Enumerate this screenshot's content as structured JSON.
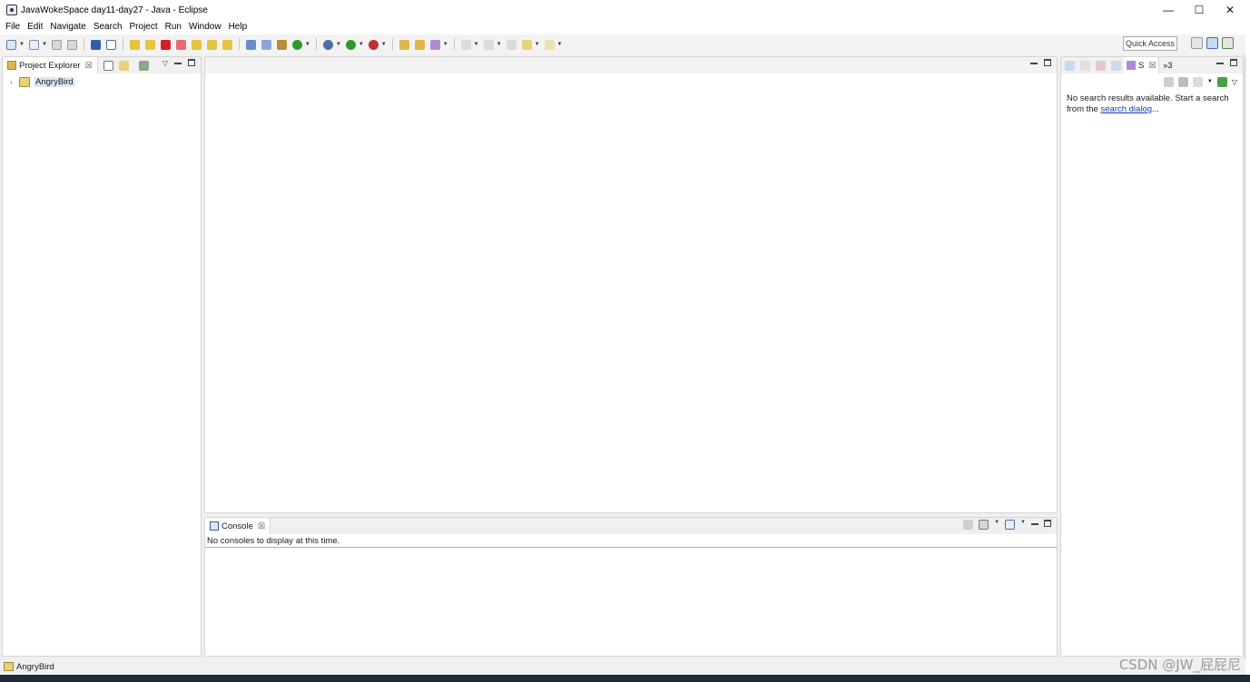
{
  "window": {
    "title": "JavaWokeSpace day11-day27 - Java - Eclipse",
    "controls": {
      "minimize": "—",
      "maximize": "☐",
      "close": "✕"
    }
  },
  "menubar": {
    "items": [
      "File",
      "Edit",
      "Navigate",
      "Search",
      "Project",
      "Run",
      "Window",
      "Help"
    ]
  },
  "toolbar": {
    "quick_access": "Quick Access",
    "colors": {
      "run": "#2d9a2d",
      "stop": "#d32020",
      "debug": "#4a6ea8",
      "folder": "#e0b74c"
    }
  },
  "project_explorer": {
    "tab_label": "Project Explorer",
    "close_glyph": "☒",
    "tree": [
      {
        "label": "AngryBird",
        "arrow": "›"
      }
    ]
  },
  "search_view": {
    "tab_label": "S",
    "close_glyph": "☒",
    "overflow": "»3",
    "message_pre": "No search results available. Start a search from the ",
    "link_text": "search dialog",
    "message_post": "..."
  },
  "console": {
    "tab_label": "Console",
    "close_glyph": "☒",
    "message": "No consoles to display at this time."
  },
  "statusbar": {
    "text": "AngryBird"
  },
  "watermark": {
    "text": "CSDN @JW_屁屁尼"
  }
}
